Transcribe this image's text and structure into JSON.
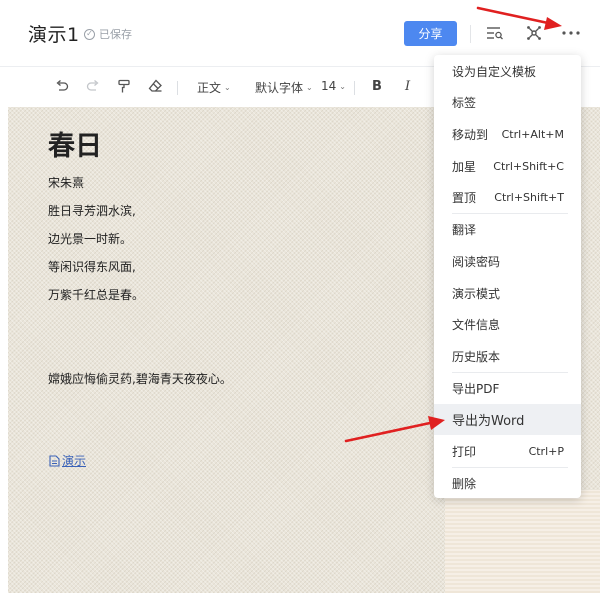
{
  "header": {
    "doc_title": "演示1",
    "saved_status": "已保存",
    "share_label": "分享"
  },
  "icons": {
    "undo": "undo-icon",
    "redo": "redo-icon",
    "format_painter": "format-painter-icon",
    "eraser": "eraser-icon",
    "outline": "outline-search-icon",
    "mindmap": "mindmap-icon",
    "more": "more-icon",
    "arrow": "red-arrow-annotation"
  },
  "toolbar": {
    "style_label": "正文",
    "font_label": "默认字体",
    "size_label": "14",
    "bold_label": "B",
    "italic_label": "I"
  },
  "document": {
    "title": "春日",
    "author": "宋朱熹",
    "lines": [
      "胜日寻芳泗水滨,",
      "边光景一时新。",
      "等闲识得东风面,",
      "万紫千红总是春。"
    ],
    "extra_line": "嫦娥应悔偷灵药,碧海青天夜夜心。",
    "link_text": "演示"
  },
  "menu": {
    "items": [
      {
        "label": "设为自定义模板",
        "shortcut": ""
      },
      {
        "label": "标签",
        "shortcut": ""
      },
      {
        "label": "移动到",
        "shortcut": "Ctrl+Alt+M"
      },
      {
        "label": "加星",
        "shortcut": "Ctrl+Shift+C"
      },
      {
        "label": "置顶",
        "shortcut": "Ctrl+Shift+T"
      },
      {
        "label": "翻译",
        "shortcut": ""
      },
      {
        "label": "阅读密码",
        "shortcut": ""
      },
      {
        "label": "演示模式",
        "shortcut": ""
      },
      {
        "label": "文件信息",
        "shortcut": ""
      },
      {
        "label": "历史版本",
        "shortcut": ""
      },
      {
        "label": "导出PDF",
        "shortcut": ""
      },
      {
        "label": "导出为Word",
        "shortcut": ""
      },
      {
        "label": "打印",
        "shortcut": "Ctrl+P"
      },
      {
        "label": "删除",
        "shortcut": ""
      }
    ],
    "highlighted": "导出为Word"
  },
  "colors": {
    "accent": "#4d88f0",
    "canvas": "#eae5da",
    "link": "#3a62b8",
    "annotation": "#e02020",
    "menu_highlight": "#eef0f3"
  }
}
